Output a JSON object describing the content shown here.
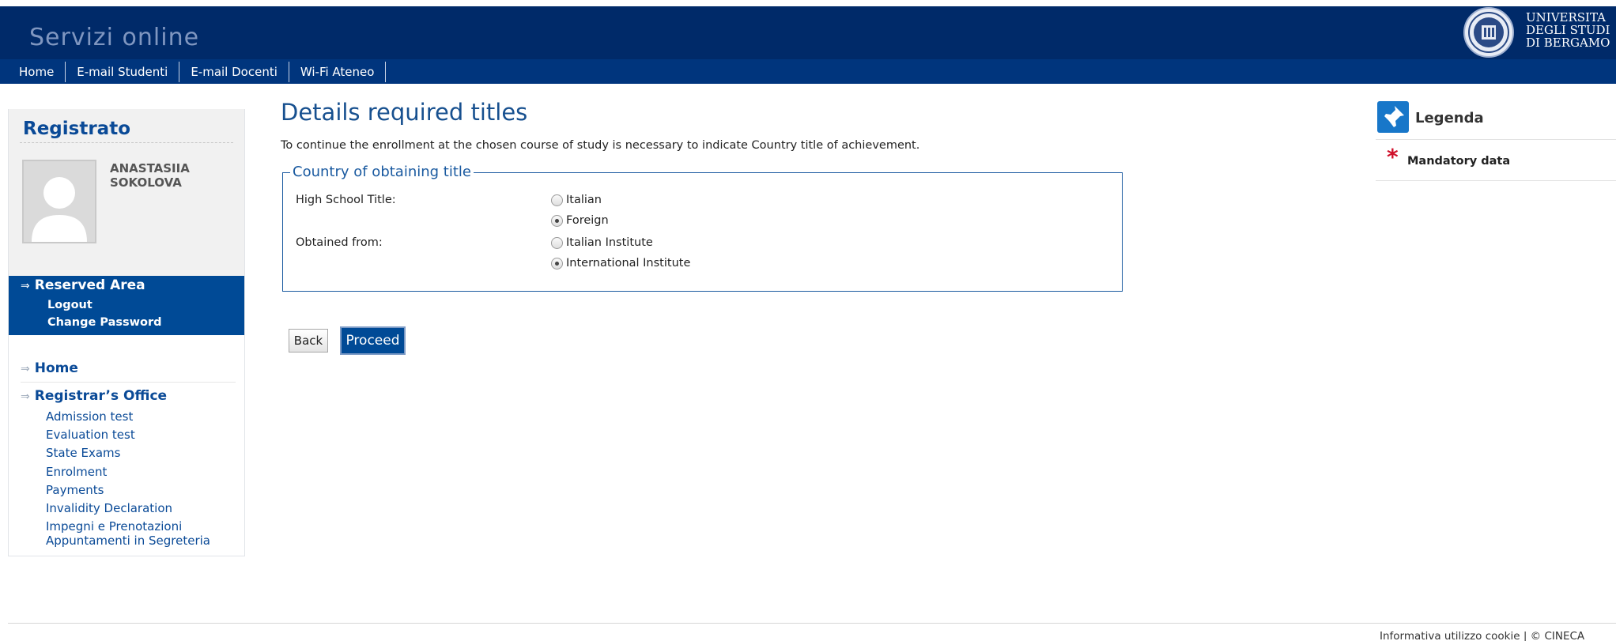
{
  "header": {
    "site_title": "Servizi online",
    "university_name": "UNIVERSITA\nDEGLI STUDI\nDI BERGAMO"
  },
  "navbar": {
    "items": [
      "Home",
      "E-mail Studenti",
      "E-mail Docenti",
      "Wi-Fi Ateneo"
    ]
  },
  "sidebar": {
    "heading": "Registrato",
    "user_name": "ANASTASIIA\nSOKOLOVA",
    "reserved_area": {
      "title": "Reserved Area",
      "links": [
        "Logout",
        "Change Password"
      ]
    },
    "home": "Home",
    "registrar": "Registrar’s Office",
    "registrar_links": [
      "Admission test",
      "Evaluation test",
      "State Exams",
      "Enrolment",
      "Payments",
      "Invalidity Declaration",
      "Impegni e Prenotazioni\nAppuntamenti in Segreteria"
    ]
  },
  "main": {
    "title": "Details required titles",
    "intro": "To continue the enrollment at the chosen course of study is necessary to indicate Country title of achievement.",
    "fieldset_legend": "Country of obtaining title",
    "high_school_label": "High School Title:",
    "high_school_options": [
      {
        "label": "Italian",
        "checked": false
      },
      {
        "label": "Foreign",
        "checked": true
      }
    ],
    "obtained_label": "Obtained from:",
    "obtained_options": [
      {
        "label": "Italian Institute",
        "checked": false
      },
      {
        "label": "International Institute",
        "checked": true
      }
    ],
    "back_label": "Back",
    "proceed_label": "Proceed"
  },
  "legend_panel": {
    "title": "Legenda",
    "mandatory_label": "Mandatory data",
    "mandatory_symbol": "*"
  },
  "footer": {
    "text": "Informativa utilizzo cookie | © CINECA"
  },
  "colors": {
    "header_bg": "#002a69",
    "navbar_bg": "#00357d",
    "accent_blue": "#004a96",
    "title_blue": "#17508f",
    "mandatory_red": "#d0102a"
  },
  "icons": {
    "university_logo": "university-seal-icon",
    "avatar": "user-avatar-icon",
    "legenda": "pin-icon",
    "arrow": "arrow-right-icon"
  }
}
